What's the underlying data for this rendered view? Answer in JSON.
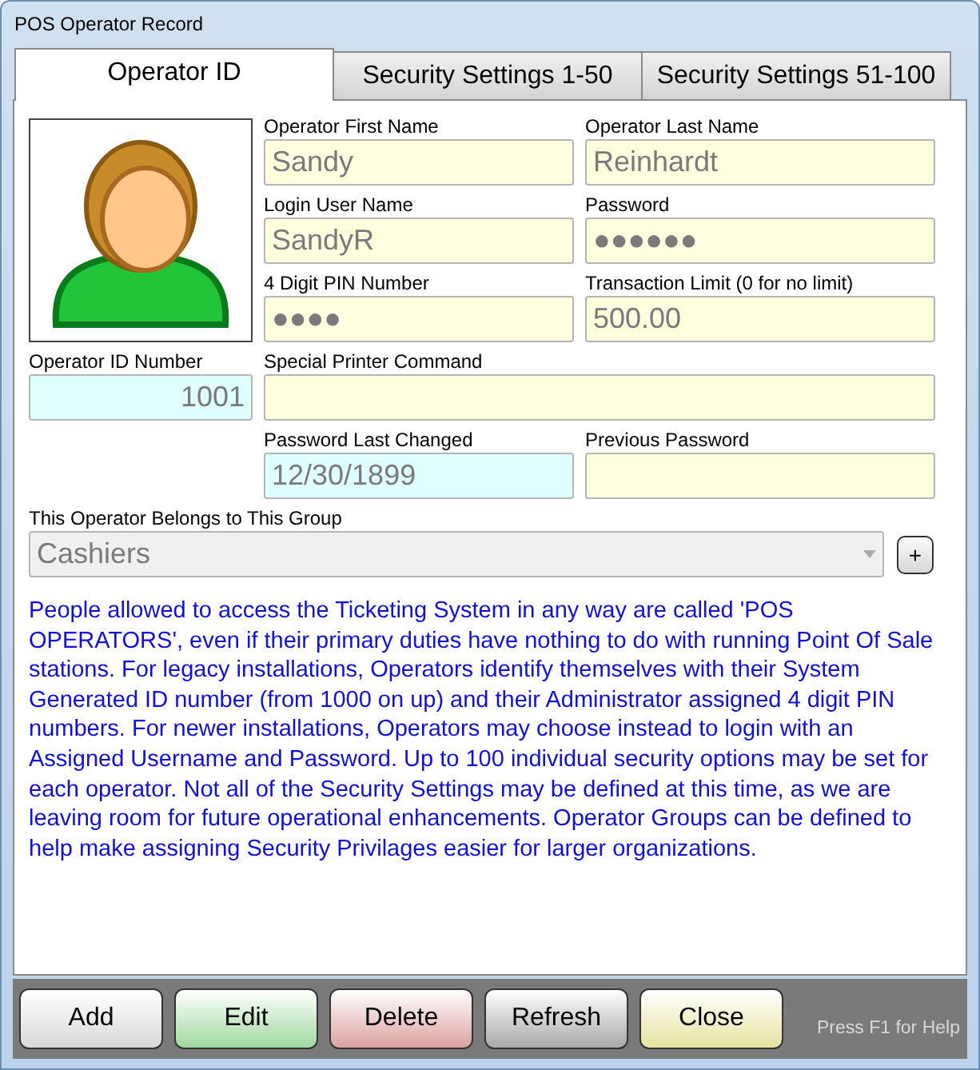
{
  "window": {
    "title": "POS Operator Record"
  },
  "tabs": [
    {
      "label": "Operator ID",
      "selected": true
    },
    {
      "label": "Security Settings 1-50",
      "selected": false
    },
    {
      "label": "Security Settings 51-100",
      "selected": false
    }
  ],
  "fields": [
    {
      "label": "Operator First Name",
      "value": "Sandy",
      "color": "#ffffe0"
    },
    {
      "label": "Operator Last Name",
      "value": "Reinhardt",
      "color": "#ffffe0"
    },
    {
      "label": "Login User Name",
      "value": "SandyR",
      "color": "#ffffe0"
    },
    {
      "label": "Password",
      "value": "●●●●●●",
      "color": "#ffffe0"
    },
    {
      "label": "4 Digit PIN Number",
      "value": "●●●●",
      "color": "#ffffe0"
    },
    {
      "label": "Transaction Limit (0 for no limit)",
      "value": "500.00",
      "color": "#ffffe0"
    },
    {
      "label": "Operator ID Number",
      "value": "1001",
      "color": "#e0ffff"
    },
    {
      "label": "Special Printer Command",
      "color": "#ffffe0"
    },
    {
      "label": "Password Last Changed",
      "value": "12/30/1899",
      "color": "#e0ffff"
    },
    {
      "label": "Previous Password",
      "color": "#ffffe0"
    }
  ],
  "group": {
    "label": "This Operator Belongs to This Group",
    "value": "Cashiers",
    "add_button": "+"
  },
  "description": "People allowed to access the Ticketing System in any way are called 'POS OPERATORS', even if their primary duties have nothing to do with running Point Of Sale stations.  For legacy installations, Operators identify themselves with their System Generated ID number (from 1000 on up) and their Administrator assigned 4 digit PIN numbers.  For newer installations, Operators may choose instead to login with an Assigned Username and Password.  Up to 100 individual security options may be set for each operator.  Not all of the Security Settings may be defined at this time, as we are leaving room for future operational enhancements.  Operator Groups can be defined to help make assigning Security Privilages easier for larger organizations.",
  "buttons": [
    {
      "label": "Add",
      "color": "#d8d8d8"
    },
    {
      "label": "Edit",
      "color": "#9fd99f"
    },
    {
      "label": "Delete",
      "color": "#dca0a0"
    },
    {
      "label": "Refresh",
      "color": "#a8a8a8"
    },
    {
      "label": "Close",
      "color": "#e6e3a0"
    }
  ],
  "help": "Press F1 for Help"
}
